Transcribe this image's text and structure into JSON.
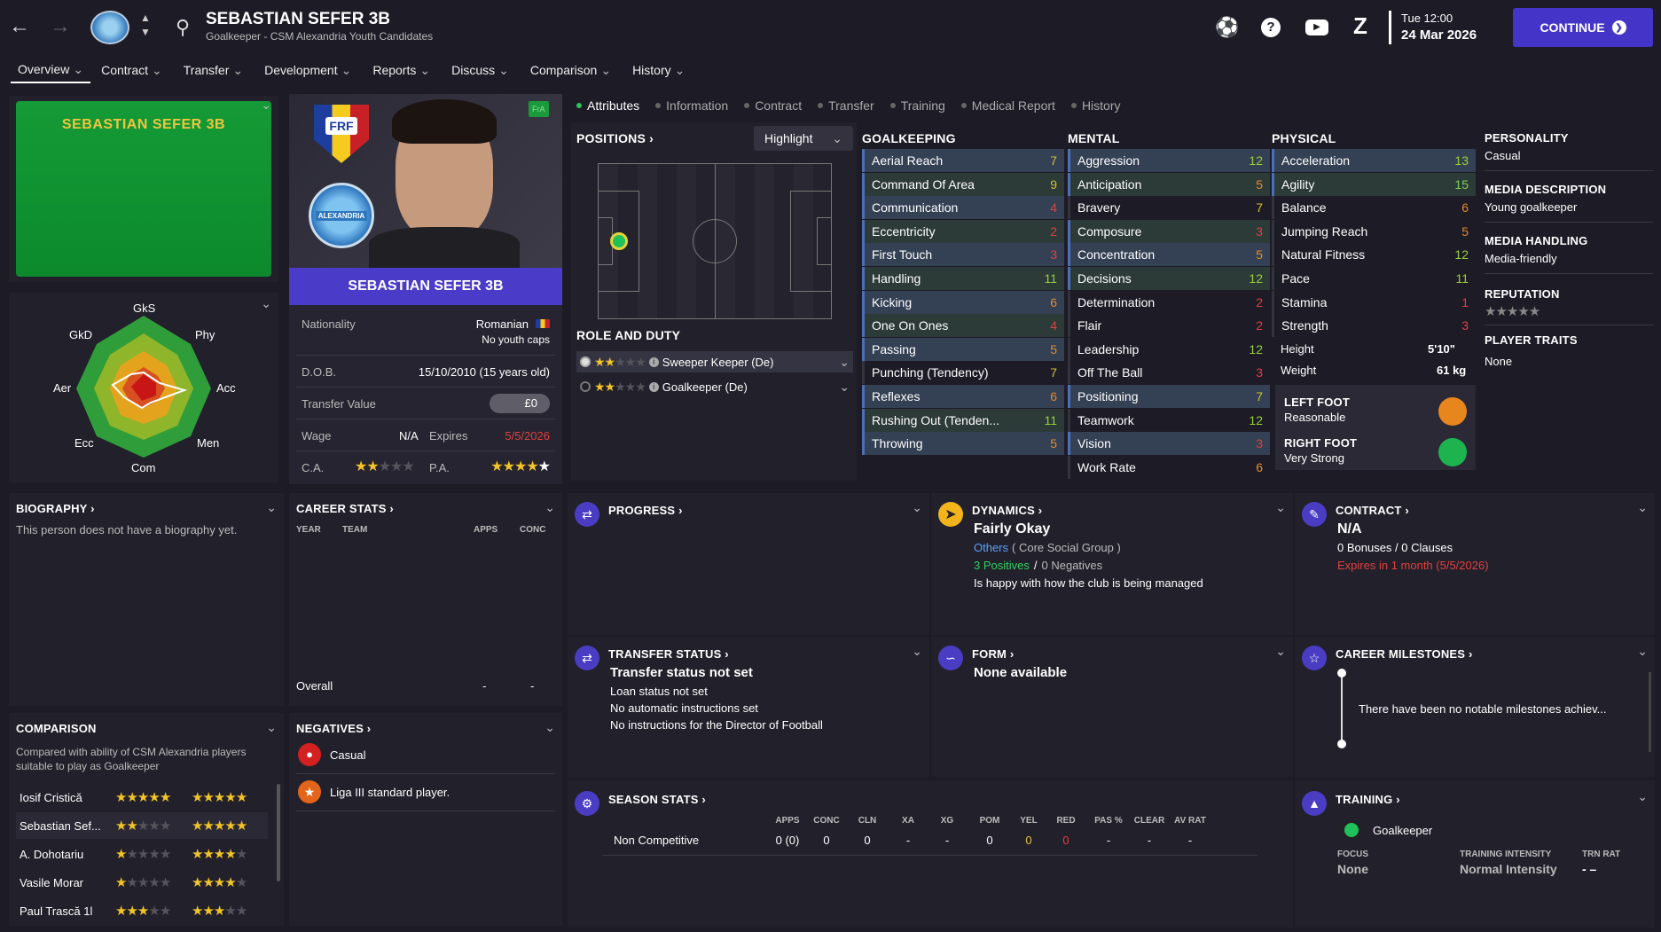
{
  "topbar": {
    "player_name": "SEBASTIAN SEFER 3B",
    "subtitle": "Goalkeeper - CSM Alexandria Youth Candidates",
    "day_time": "Tue 12:00",
    "date": "24 Mar 2026",
    "continue": "CONTINUE"
  },
  "nav": [
    "Overview",
    "Contract",
    "Transfer",
    "Development",
    "Reports",
    "Discuss",
    "Comparison",
    "History"
  ],
  "kit_label": "SEBASTIAN SEFER 3B",
  "radar": {
    "labels": [
      "GkS",
      "Phy",
      "Acc",
      "Men",
      "Com",
      "Ecc",
      "Aer",
      "GkD"
    ]
  },
  "profile": {
    "badge": "FrA",
    "frf": "FRF",
    "club": "ALEXANDRIA",
    "name": "SEBASTIAN SEFER 3B",
    "nationality_label": "Nationality",
    "nationality": "Romanian",
    "youth_caps": "No youth caps",
    "dob_label": "D.O.B.",
    "dob": "15/10/2010 (15 years old)",
    "tv_label": "Transfer Value",
    "tv": "£0",
    "wage_label": "Wage",
    "wage": "N/A",
    "expires_label": "Expires",
    "expires": "5/5/2026",
    "ca_label": "C.A.",
    "pa_label": "P.A.",
    "ca_stars": 2,
    "pa_stars": 5
  },
  "subtabs": [
    "Attributes",
    "Information",
    "Contract",
    "Transfer",
    "Training",
    "Medical Report",
    "History"
  ],
  "positions": {
    "title": "POSITIONS",
    "highlight": "Highlight",
    "role_title": "ROLE AND DUTY",
    "roles": [
      {
        "name": "Sweeper Keeper (De)",
        "stars": 2
      },
      {
        "name": "Goalkeeper (De)",
        "stars": 2
      }
    ]
  },
  "goalkeeping": {
    "title": "GOALKEEPING",
    "items": [
      [
        "Aerial Reach",
        "7"
      ],
      [
        "Command Of Area",
        "9"
      ],
      [
        "Communication",
        "4"
      ],
      [
        "Eccentricity",
        "2"
      ],
      [
        "First Touch",
        "3"
      ],
      [
        "Handling",
        "11"
      ],
      [
        "Kicking",
        "6"
      ],
      [
        "One On Ones",
        "4"
      ],
      [
        "Passing",
        "5"
      ],
      [
        "Punching (Tendency)",
        "7"
      ],
      [
        "Reflexes",
        "6"
      ],
      [
        "Rushing Out (Tenden...",
        "11"
      ],
      [
        "Throwing",
        "5"
      ]
    ]
  },
  "mental": {
    "title": "MENTAL",
    "items": [
      [
        "Aggression",
        "12"
      ],
      [
        "Anticipation",
        "5"
      ],
      [
        "Bravery",
        "7"
      ],
      [
        "Composure",
        "3"
      ],
      [
        "Concentration",
        "5"
      ],
      [
        "Decisions",
        "12"
      ],
      [
        "Determination",
        "2"
      ],
      [
        "Flair",
        "2"
      ],
      [
        "Leadership",
        "12"
      ],
      [
        "Off The Ball",
        "3"
      ],
      [
        "Positioning",
        "7"
      ],
      [
        "Teamwork",
        "12"
      ],
      [
        "Vision",
        "3"
      ],
      [
        "Work Rate",
        "6"
      ]
    ]
  },
  "physical": {
    "title": "PHYSICAL",
    "items": [
      [
        "Acceleration",
        "13"
      ],
      [
        "Agility",
        "15"
      ],
      [
        "Balance",
        "6"
      ],
      [
        "Jumping Reach",
        "5"
      ],
      [
        "Natural Fitness",
        "12"
      ],
      [
        "Pace",
        "11"
      ],
      [
        "Stamina",
        "1"
      ],
      [
        "Strength",
        "3"
      ]
    ],
    "height_label": "Height",
    "height": "5'10\"",
    "weight_label": "Weight",
    "weight": "61 kg",
    "left_foot_label": "LEFT FOOT",
    "left_foot": "Reasonable",
    "right_foot_label": "RIGHT FOOT",
    "right_foot": "Very Strong"
  },
  "personality": {
    "title": "PERSONALITY",
    "value": "Casual",
    "media_desc_title": "MEDIA DESCRIPTION",
    "media_desc": "Young goalkeeper",
    "media_handling_title": "MEDIA HANDLING",
    "media_handling": "Media-friendly",
    "reputation_title": "REPUTATION",
    "reputation_stars": 5,
    "traits_title": "PLAYER TRAITS",
    "traits": "None"
  },
  "biography": {
    "title": "BIOGRAPHY",
    "text": "This person does not have a biography yet."
  },
  "career": {
    "title": "CAREER STATS",
    "cols": [
      "YEAR",
      "TEAM",
      "APPS",
      "CONC"
    ],
    "overall": "Overall",
    "apps": "-",
    "conc": "-"
  },
  "comparison": {
    "title": "COMPARISON",
    "desc": "Compared with ability of CSM Alexandria players suitable to play as Goalkeeper",
    "players": [
      {
        "name": "Iosif Cristică",
        "ca": 4.5,
        "pa": 5
      },
      {
        "name": "Sebastian Sef...",
        "ca": 2,
        "pa": 5
      },
      {
        "name": "A. Dohotariu",
        "ca": 1,
        "pa": 4
      },
      {
        "name": "Vasile Morar",
        "ca": 1,
        "pa": 3.5
      },
      {
        "name": "Paul Trască 1l",
        "ca": 3,
        "pa": 3
      }
    ]
  },
  "negatives": {
    "title": "NEGATIVES",
    "items": [
      "Casual",
      "Liga III standard player."
    ]
  },
  "progress": {
    "title": "PROGRESS"
  },
  "dynamics": {
    "title": "DYNAMICS",
    "status": "Fairly Okay",
    "group_link": "Others",
    "group": "( Core Social Group )",
    "positives": "3 Positives",
    "sep": "/",
    "negatives": "0 Negatives",
    "note": "Is happy with how the club is being managed"
  },
  "contract": {
    "title": "CONTRACT",
    "value": "N/A",
    "bonuses": "0 Bonuses / 0 Clauses",
    "expiry": "Expires in 1 month (5/5/2026)"
  },
  "transfer_status": {
    "title": "TRANSFER STATUS",
    "headline": "Transfer status not set",
    "lines": [
      "Loan status not set",
      "No automatic instructions set",
      "No instructions for the Director of Football"
    ]
  },
  "form": {
    "title": "FORM",
    "value": "None available"
  },
  "milestones": {
    "title": "CAREER MILESTONES",
    "text": "There have been no notable milestones achiev..."
  },
  "season": {
    "title": "SEASON STATS",
    "cols": [
      "APPS",
      "CONC",
      "CLN",
      "XA",
      "XG",
      "POM",
      "YEL",
      "RED",
      "PAS %",
      "CLEAR",
      "AV RAT"
    ],
    "row_label": "Non Competitive",
    "values": [
      "0 (0)",
      "0",
      "0",
      "-",
      "-",
      "0",
      "0",
      "0",
      "-",
      "-",
      "-"
    ]
  },
  "training": {
    "title": "TRAINING",
    "position": "Goalkeeper",
    "focus_label": "FOCUS",
    "focus": "None",
    "intensity_label": "TRAINING INTENSITY",
    "intensity": "Normal Intensity",
    "trn_label": "TRN RAT",
    "trn": "- –"
  }
}
